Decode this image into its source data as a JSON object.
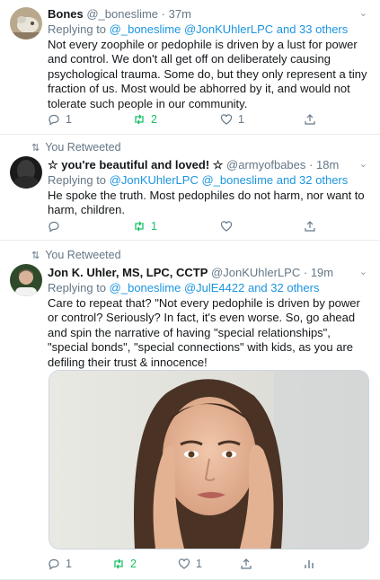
{
  "tweets": [
    {
      "name": "Bones",
      "handle": "@_boneslime",
      "time": "37m",
      "reply_prefix": "Replying to ",
      "reply_targets": "@_boneslime @JonKUhlerLPC and 33 others",
      "text": "Not every zoophile or pedophile is driven by a lust for power and control. We don't all get off on deliberately causing psychological trauma. Some do, but they only represent a tiny fraction of us. Most would be abhorred by it, and would not tolerate such people in our community.",
      "replies": "1",
      "retweets": "2",
      "likes": "1"
    },
    {
      "retweet_label": "You Retweeted",
      "name": "☆ you're beautiful and loved! ☆",
      "handle": "@armyofbabes",
      "time": "18m",
      "reply_prefix": "Replying to ",
      "reply_targets": "@JonKUhlerLPC @_boneslime and 32 others",
      "text": "He spoke the truth. Most pedophiles do not harm, nor want to harm, children.",
      "retweets": "1"
    },
    {
      "retweet_label": "You Retweeted",
      "name": "Jon K. Uhler, MS, LPC, CCTP",
      "handle": "@JonKUhlerLPC",
      "time": "19m",
      "reply_prefix": "Replying to ",
      "reply_targets": "@_boneslime @JulE4422 and 32 others",
      "text": "Care to repeat that? \"Not every pedophile is driven by power or control? Seriously? In fact, it's even worse. So, go ahead and spin the narrative of having \"special relationships\", \"special bonds\", \"special connections\" with kids, as you are defiling their trust & innocence!",
      "replies": "1",
      "retweets": "2",
      "likes": "1"
    }
  ],
  "colors": {
    "link": "#1b95e0",
    "retweet_green": "#17bf63",
    "muted": "#657786"
  },
  "icons": [
    "reply-icon",
    "retweet-icon",
    "like-icon",
    "share-icon",
    "analytics-icon",
    "chevron-down-icon"
  ]
}
